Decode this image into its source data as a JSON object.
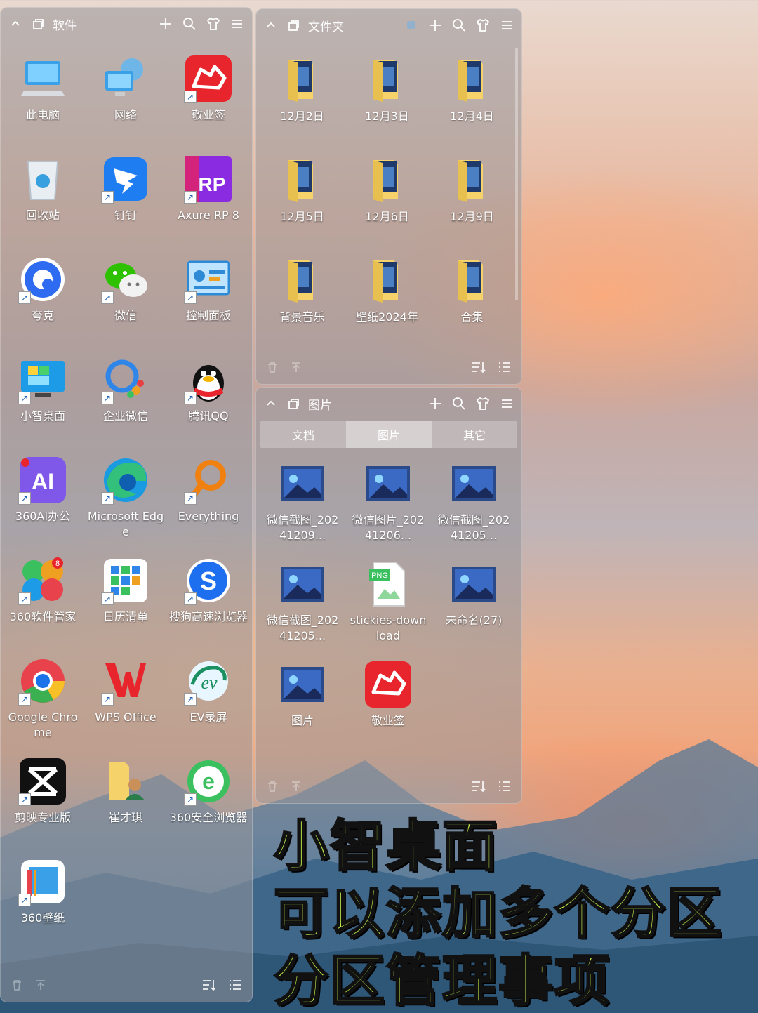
{
  "panels": {
    "software": {
      "title": "软件",
      "items": [
        {
          "label": "此电脑",
          "icon": "computer-icon"
        },
        {
          "label": "网络",
          "icon": "network-icon"
        },
        {
          "label": "敬业签",
          "icon": "jingyeqian-icon"
        },
        {
          "label": "回收站",
          "icon": "recycle-bin-icon"
        },
        {
          "label": "钉钉",
          "icon": "dingtalk-icon"
        },
        {
          "label": "Axure RP 8",
          "icon": "axure-icon"
        },
        {
          "label": "夸克",
          "icon": "quark-icon"
        },
        {
          "label": "微信",
          "icon": "wechat-icon"
        },
        {
          "label": "控制面板",
          "icon": "control-panel-icon"
        },
        {
          "label": "小智桌面",
          "icon": "xiaozhi-desktop-icon"
        },
        {
          "label": "企业微信",
          "icon": "wecom-icon"
        },
        {
          "label": "腾讯QQ",
          "icon": "qq-icon"
        },
        {
          "label": "360AI办公",
          "icon": "360ai-icon"
        },
        {
          "label": "Microsoft Edge",
          "icon": "edge-icon"
        },
        {
          "label": "Everything",
          "icon": "everything-icon"
        },
        {
          "label": "360软件管家",
          "icon": "360-software-manager-icon"
        },
        {
          "label": "日历清单",
          "icon": "calendar-list-icon"
        },
        {
          "label": "搜狗高速浏览器",
          "icon": "sogou-browser-icon"
        },
        {
          "label": "Google Chrome",
          "icon": "chrome-icon"
        },
        {
          "label": "WPS Office",
          "icon": "wps-icon"
        },
        {
          "label": "EV录屏",
          "icon": "ev-recorder-icon"
        },
        {
          "label": "剪映专业版",
          "icon": "capcut-icon"
        },
        {
          "label": "崔才琪",
          "icon": "user-folder-icon"
        },
        {
          "label": "360安全浏览器",
          "icon": "360-browser-icon"
        },
        {
          "label": "360壁纸",
          "icon": "360-wallpaper-icon"
        }
      ]
    },
    "folders": {
      "title": "文件夹",
      "items": [
        {
          "label": "12月2日",
          "icon": "folder-icon"
        },
        {
          "label": "12月3日",
          "icon": "folder-icon"
        },
        {
          "label": "12月4日",
          "icon": "folder-icon"
        },
        {
          "label": "12月5日",
          "icon": "folder-icon"
        },
        {
          "label": "12月6日",
          "icon": "folder-icon"
        },
        {
          "label": "12月9日",
          "icon": "folder-icon"
        },
        {
          "label": "背景音乐",
          "icon": "folder-icon"
        },
        {
          "label": "壁纸2024年",
          "icon": "folder-icon"
        },
        {
          "label": "合集",
          "icon": "folder-icon"
        }
      ]
    },
    "pictures": {
      "title": "图片",
      "tabs": [
        "文档",
        "图片",
        "其它"
      ],
      "active_tab": "图片",
      "items": [
        {
          "label": "微信截图_20241209...",
          "icon": "image-thumbnail-icon"
        },
        {
          "label": "微信图片_20241206...",
          "icon": "image-thumbnail-icon"
        },
        {
          "label": "微信截图_20241205...",
          "icon": "image-thumbnail-icon"
        },
        {
          "label": "微信截图_20241205...",
          "icon": "image-thumbnail-icon"
        },
        {
          "label": "stickies-download",
          "icon": "png-file-icon"
        },
        {
          "label": "未命名(27)",
          "icon": "image-thumbnail-icon"
        },
        {
          "label": "图片",
          "icon": "image-thumbnail-icon"
        },
        {
          "label": "敬业签",
          "icon": "jingyeqian-icon"
        }
      ]
    }
  },
  "caption": {
    "line1": "小智桌面",
    "line2": "可以添加多个分区",
    "line3": "分区管理事项"
  },
  "colors": {
    "caption_fill": "#c6f34a",
    "panel_bg": "rgba(150,150,155,0.55)"
  }
}
